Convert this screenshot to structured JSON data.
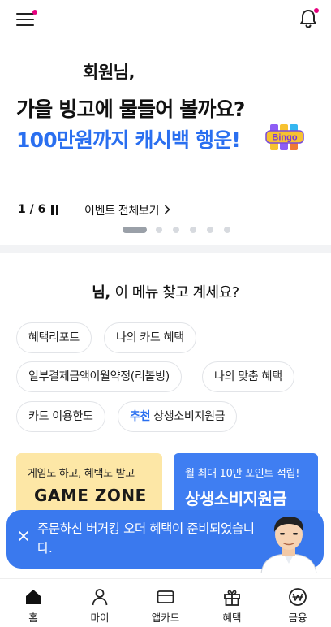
{
  "header": {
    "menu_icon": "hamburger-menu-icon",
    "bell_icon": "bell-icon",
    "badge_color": "#e6007e"
  },
  "banner": {
    "greeting": "회원님,",
    "headline_1": "가을 빙고에 물들어 볼까요?",
    "headline_2": "100만원까지 캐시백 행운!",
    "sticker_text": "Bingo",
    "pager": "1 / 6",
    "event_all": "이벤트 전체보기",
    "accent_color": "#2a6ff0"
  },
  "suggest": {
    "title_bold": "님,",
    "title_rest": "이 메뉴 찾고 계세요?",
    "chips": [
      {
        "label": "혜택리포트"
      },
      {
        "label": "나의 카드 혜택"
      },
      {
        "label": "일부결제금액이월약정(리볼빙)"
      },
      {
        "label": "나의 맞춤 혜택"
      },
      {
        "label": "카드 이용한도"
      },
      {
        "tag": "추천",
        "label": "상생소비지원금"
      }
    ]
  },
  "cards": {
    "game": {
      "caption": "게임도 하고, 혜택도 받고",
      "logo": "GAME ZONE"
    },
    "points": {
      "caption": "월 최대 10만 포인트 적립!",
      "title": "상생소비지원금"
    }
  },
  "toast": {
    "message": "주문하신 버거킹 오더 혜택이 준비되었습니다.",
    "close_icon": "close-icon"
  },
  "tabbar": {
    "items": [
      {
        "label": "홈",
        "icon": "home-icon"
      },
      {
        "label": "마이",
        "icon": "person-icon"
      },
      {
        "label": "앱카드",
        "icon": "card-icon"
      },
      {
        "label": "혜택",
        "icon": "gift-icon"
      },
      {
        "label": "금융",
        "icon": "won-circle-icon"
      }
    ]
  }
}
